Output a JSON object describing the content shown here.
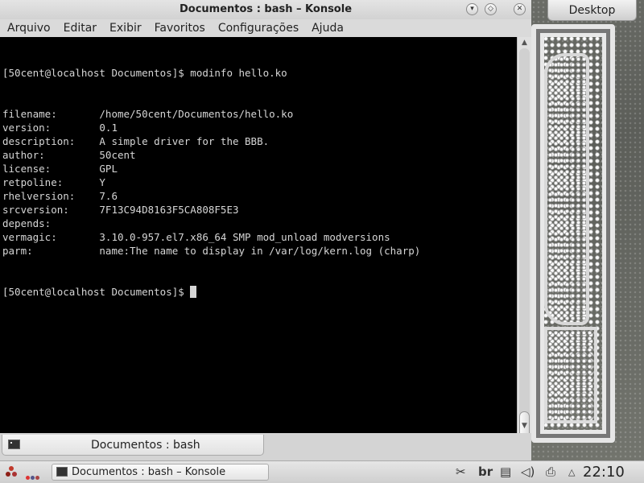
{
  "desktop": {
    "button_label": "Desktop"
  },
  "window": {
    "title": "Documentos : bash – Konsole",
    "menu": [
      "Arquivo",
      "Editar",
      "Exibir",
      "Favoritos",
      "Configurações",
      "Ajuda"
    ]
  },
  "terminal": {
    "prompt": "[50cent@localhost Documentos]$ ",
    "command": "modinfo hello.ko",
    "fields": [
      {
        "key": "filename:",
        "value": "/home/50cent/Documentos/hello.ko"
      },
      {
        "key": "version:",
        "value": "0.1"
      },
      {
        "key": "description:",
        "value": "A simple driver for the BBB."
      },
      {
        "key": "author:",
        "value": "50cent"
      },
      {
        "key": "license:",
        "value": "GPL"
      },
      {
        "key": "retpoline:",
        "value": "Y"
      },
      {
        "key": "rhelversion:",
        "value": "7.6"
      },
      {
        "key": "srcversion:",
        "value": "7F13C94D8163F5CA808F5E3"
      },
      {
        "key": "depends:",
        "value": ""
      },
      {
        "key": "vermagic:",
        "value": "3.10.0-957.el7.x86_64 SMP mod_unload modversions"
      },
      {
        "key": "parm:",
        "value": "name:The name to display in /var/log/kern.log (charp)"
      }
    ],
    "final_prompt": "[50cent@localhost Documentos]$ "
  },
  "konsole_tab": {
    "label": "Documentos : bash"
  },
  "taskbar": {
    "task_label": "Documentos : bash – Konsole",
    "keyboard_layout": "br",
    "clock": "22:10"
  },
  "colors": {
    "terminal_bg": "#000000",
    "terminal_fg": "#d6d6d6"
  }
}
